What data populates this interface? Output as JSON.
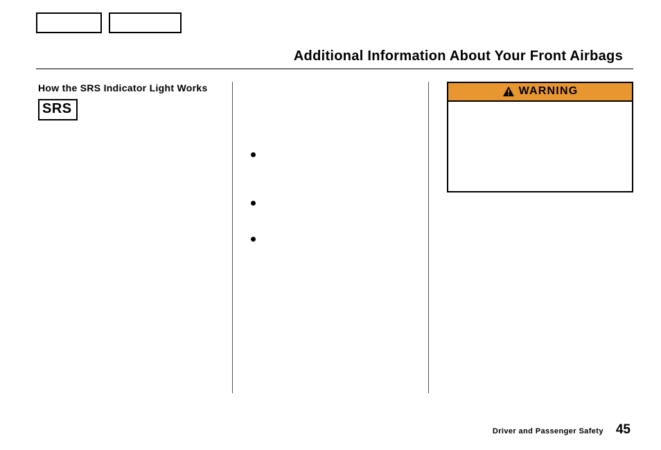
{
  "header": {
    "title": "Additional Information About Your Front Airbags"
  },
  "column1": {
    "heading": "How the SRS Indicator Light Works",
    "badge": "SRS"
  },
  "column2": {
    "bullets": [
      "",
      "",
      ""
    ]
  },
  "column3": {
    "warning_label": "WARNING"
  },
  "footer": {
    "section": "Driver and Passenger Safety",
    "page_number": "45"
  }
}
